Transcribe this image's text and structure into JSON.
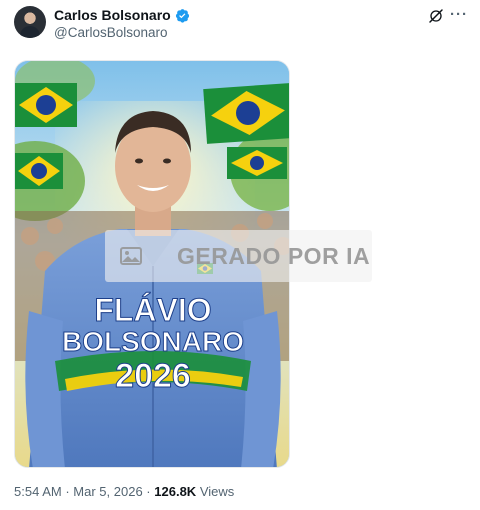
{
  "author": {
    "display_name": "Carlos Bolsonaro",
    "handle": "@CarlosBolsonaro",
    "verified": true,
    "avatar_icon": "avatar-photo"
  },
  "header_icons": {
    "grok": "grok-icon",
    "more": "more-icon"
  },
  "media": {
    "poster_line1": "FLÁVIO",
    "poster_line2": "BOLSONARO",
    "poster_line3": "2026",
    "watermark_text": "GERADO POR IA",
    "flag_colors": {
      "green": "#1b8f3a",
      "yellow": "#f6d10e",
      "blue": "#1c3f94"
    }
  },
  "footer": {
    "time": "5:54 AM",
    "separator": "·",
    "date": "Mar 5, 2026",
    "views_count": "126.8K",
    "views_label": "Views"
  },
  "colors": {
    "text_primary": "#0f1419",
    "text_secondary": "#536471",
    "verified_blue": "#1d9bf0"
  }
}
